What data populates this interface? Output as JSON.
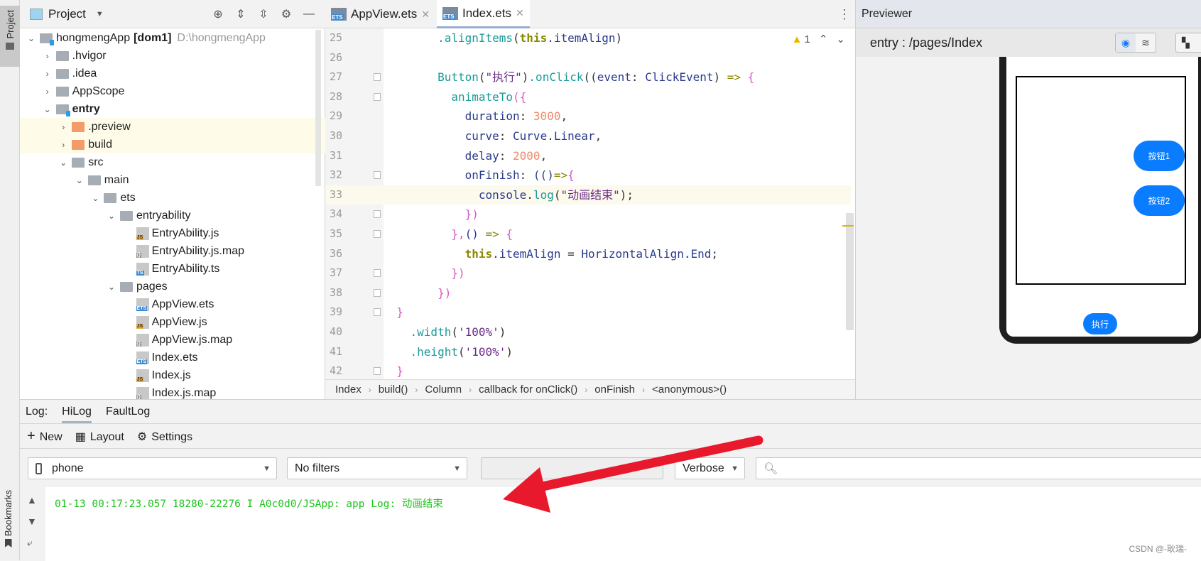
{
  "sidebar": {
    "project_tab": "Project",
    "bookmarks_tab": "Bookmarks"
  },
  "project": {
    "title": "Project",
    "tree": [
      {
        "label": "hongmengApp",
        "badge": "[dom1]",
        "path": "D:\\hongmengApp",
        "level": 0,
        "kind": "module",
        "open": true
      },
      {
        "label": ".hvigor",
        "level": 1,
        "kind": "folder",
        "open": false
      },
      {
        "label": ".idea",
        "level": 1,
        "kind": "folder",
        "open": false
      },
      {
        "label": "AppScope",
        "level": 1,
        "kind": "folder",
        "open": false
      },
      {
        "label": "entry",
        "level": 1,
        "kind": "module",
        "open": true,
        "bold": true
      },
      {
        "label": ".preview",
        "level": 2,
        "kind": "orange",
        "open": false,
        "hl": true
      },
      {
        "label": "build",
        "level": 2,
        "kind": "orange",
        "open": false,
        "hl": true
      },
      {
        "label": "src",
        "level": 2,
        "kind": "folder",
        "open": true
      },
      {
        "label": "main",
        "level": 3,
        "kind": "folder",
        "open": true
      },
      {
        "label": "ets",
        "level": 4,
        "kind": "folder",
        "open": true
      },
      {
        "label": "entryability",
        "level": 5,
        "kind": "folder",
        "open": true
      },
      {
        "label": "EntryAbility.js",
        "level": 6,
        "kind": "js"
      },
      {
        "label": "EntryAbility.js.map",
        "level": 6,
        "kind": "map"
      },
      {
        "label": "EntryAbility.ts",
        "level": 6,
        "kind": "ts"
      },
      {
        "label": "pages",
        "level": 5,
        "kind": "folder",
        "open": true
      },
      {
        "label": "AppView.ets",
        "level": 6,
        "kind": "ets"
      },
      {
        "label": "AppView.js",
        "level": 6,
        "kind": "js"
      },
      {
        "label": "AppView.js.map",
        "level": 6,
        "kind": "map"
      },
      {
        "label": "Index.ets",
        "level": 6,
        "kind": "ets"
      },
      {
        "label": "Index.js",
        "level": 6,
        "kind": "js"
      },
      {
        "label": "Index.js.map",
        "level": 6,
        "kind": "map"
      }
    ]
  },
  "editor": {
    "tabs": [
      {
        "label": "AppView.ets",
        "active": false
      },
      {
        "label": "Index.ets",
        "active": true
      }
    ],
    "warnings": "1",
    "lines": [
      {
        "n": "25",
        "t": [
          [
            "        ",
            "x"
          ],
          [
            ".alignItems",
            "m"
          ],
          [
            "(",
            "x"
          ],
          [
            "this",
            "k"
          ],
          [
            ".itemAlign",
            "p"
          ],
          [
            ")",
            "x"
          ]
        ]
      },
      {
        "n": "26",
        "t": []
      },
      {
        "n": "27",
        "fold": true,
        "t": [
          [
            "        ",
            "x"
          ],
          [
            "Button",
            "m"
          ],
          [
            "(",
            "x"
          ],
          [
            "\"执行\"",
            "s"
          ],
          [
            ")",
            "x"
          ],
          [
            ".onClick",
            "m"
          ],
          [
            "((",
            "x"
          ],
          [
            "event",
            "p"
          ],
          [
            ": ",
            "x"
          ],
          [
            "ClickEvent",
            "p"
          ],
          [
            ") ",
            "x"
          ],
          [
            "=>",
            "o"
          ],
          [
            " {",
            "b"
          ]
        ]
      },
      {
        "n": "28",
        "fold": true,
        "t": [
          [
            "          ",
            "x"
          ],
          [
            "animateTo",
            "m"
          ],
          [
            "({",
            "b"
          ]
        ]
      },
      {
        "n": "29",
        "t": [
          [
            "            ",
            "x"
          ],
          [
            "duration",
            "p"
          ],
          [
            ": ",
            "x"
          ],
          [
            "3000",
            "n"
          ],
          [
            ",",
            "x"
          ]
        ]
      },
      {
        "n": "30",
        "t": [
          [
            "            ",
            "x"
          ],
          [
            "curve",
            "p"
          ],
          [
            ": ",
            "x"
          ],
          [
            "Curve",
            "p"
          ],
          [
            ".",
            "x"
          ],
          [
            "Linear",
            "p"
          ],
          [
            ",",
            "x"
          ]
        ]
      },
      {
        "n": "31",
        "t": [
          [
            "            ",
            "x"
          ],
          [
            "delay",
            "p"
          ],
          [
            ": ",
            "x"
          ],
          [
            "2000",
            "n"
          ],
          [
            ",",
            "x"
          ]
        ]
      },
      {
        "n": "32",
        "fold": true,
        "t": [
          [
            "            ",
            "x"
          ],
          [
            "onFinish",
            "p"
          ],
          [
            ": ",
            "x"
          ],
          [
            "(()",
            "p"
          ],
          [
            "=>",
            "o"
          ],
          [
            "{",
            "b"
          ]
        ]
      },
      {
        "n": "33",
        "cur": true,
        "t": [
          [
            "              ",
            "x"
          ],
          [
            "console",
            "p"
          ],
          [
            ".",
            "x"
          ],
          [
            "log",
            "m"
          ],
          [
            "(",
            "x"
          ],
          [
            "\"动画结束\"",
            "s"
          ],
          [
            ");",
            "x"
          ]
        ]
      },
      {
        "n": "34",
        "fold": true,
        "t": [
          [
            "            ",
            "x"
          ],
          [
            "})",
            "b"
          ]
        ]
      },
      {
        "n": "35",
        "fold": true,
        "t": [
          [
            "          ",
            "x"
          ],
          [
            "},",
            "b"
          ],
          [
            "() ",
            "p"
          ],
          [
            "=>",
            "o"
          ],
          [
            " {",
            "b"
          ]
        ]
      },
      {
        "n": "36",
        "t": [
          [
            "            ",
            "x"
          ],
          [
            "this",
            "k"
          ],
          [
            ".itemAlign",
            "p"
          ],
          [
            " = ",
            "x"
          ],
          [
            "HorizontalAlign",
            "p"
          ],
          [
            ".",
            "x"
          ],
          [
            "End",
            "p"
          ],
          [
            ";",
            "x"
          ]
        ]
      },
      {
        "n": "37",
        "fold": true,
        "t": [
          [
            "          ",
            "x"
          ],
          [
            "})",
            "b"
          ]
        ]
      },
      {
        "n": "38",
        "fold": true,
        "t": [
          [
            "        ",
            "x"
          ],
          [
            "})",
            "b"
          ]
        ]
      },
      {
        "n": "39",
        "fold": true,
        "t": [
          [
            "  ",
            "x"
          ],
          [
            "}",
            "b"
          ]
        ]
      },
      {
        "n": "40",
        "t": [
          [
            "    ",
            "x"
          ],
          [
            ".width",
            "m"
          ],
          [
            "(",
            "x"
          ],
          [
            "'100%'",
            "s"
          ],
          [
            ")",
            "x"
          ]
        ]
      },
      {
        "n": "41",
        "t": [
          [
            "    ",
            "x"
          ],
          [
            ".height",
            "m"
          ],
          [
            "(",
            "x"
          ],
          [
            "'100%'",
            "s"
          ],
          [
            ")",
            "x"
          ]
        ]
      },
      {
        "n": "42",
        "fold": true,
        "t": [
          [
            "  ",
            "x"
          ],
          [
            "}",
            "b"
          ]
        ]
      }
    ],
    "breadcrumb": [
      "Index",
      "build()",
      "Column",
      "callback for onClick()",
      "onFinish",
      "<anonymous>()"
    ]
  },
  "previewer": {
    "title": "Previewer",
    "route": "entry : /pages/Index",
    "buttons": {
      "b1": "按钮1",
      "b2": "按钮2",
      "run": "执行"
    },
    "accent": "#0a7cff"
  },
  "log": {
    "label": "Log:",
    "tabs": [
      "HiLog",
      "FaultLog"
    ],
    "tools": {
      "new": "New",
      "layout": "Layout",
      "settings": "Settings"
    },
    "device": "phone",
    "filter": "No filters",
    "search_text": "",
    "level": "Verbose",
    "search_placeholder": "",
    "line": "01-13 00:17:23.057 18280-22276 I A0c0d0/JSApp: app Log: 动画结束"
  },
  "watermark": "CSDN @-耿瑞-"
}
